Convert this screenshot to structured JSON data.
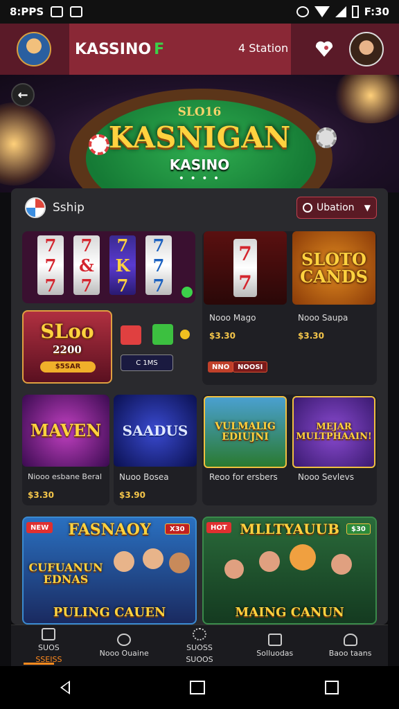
{
  "status_bar": {
    "left_text": "8:PPS",
    "time": "F:30"
  },
  "app_header": {
    "brand": "KASSINO",
    "brand_mark": "F",
    "status_label": "4 Station"
  },
  "hero": {
    "small_title": "SLO16",
    "big_title": "KASNIGAN",
    "sub_title": "KASINO",
    "dots": "• • • •"
  },
  "panel": {
    "section_label": "Sship",
    "filter_label": "Ubation"
  },
  "games": {
    "g1": {
      "reels": [
        [
          "7",
          "7",
          "7"
        ],
        [
          "7",
          "&",
          "7"
        ],
        [
          "7",
          "K",
          "7"
        ],
        [
          "7",
          "7",
          "7"
        ]
      ]
    },
    "g2": {
      "reels": [
        [
          "7",
          "7"
        ]
      ],
      "name": "Nooo Mago",
      "price": "$3.30"
    },
    "g3": {
      "title_lines": [
        "SLOTO",
        "CANDS"
      ],
      "name": "Nooo Saupa",
      "price": "$3.30"
    },
    "g4": {
      "title": "SLoo",
      "subtitle": "2200",
      "button": "$5SAR",
      "chip_label": "C 1MS"
    },
    "g4_tags": [
      "NNO",
      "NOOSI"
    ],
    "g5": {
      "title": "MAVEN",
      "name": "Niooo esbane Beral",
      "price": "$3.30"
    },
    "g6": {
      "title": "SAADUS",
      "name": "Nuoo Bosea",
      "price": "$3.90"
    },
    "g7": {
      "title_lines": [
        "VULMALIG",
        "EDIUJNI"
      ],
      "name": "Reoo for ersbers"
    },
    "g8": {
      "title_lines": [
        "MEJAR",
        "MULTPHAAIN!"
      ],
      "name": "Nooo Sevlevs"
    },
    "g9": {
      "banner": "FASNAOY",
      "badge": "X30",
      "art_lines": [
        "CUFUANUN",
        "EDNAS"
      ],
      "footer": "PULING CAUEN",
      "corner_tag": "NEW"
    },
    "g10": {
      "banner": "MLLTYAUUB",
      "badge": "$30",
      "footer": "MAING CANUN",
      "corner_tag": "HOT"
    }
  },
  "bottom_nav": [
    {
      "top": "SUOS",
      "bottom": "SSEISS"
    },
    {
      "top": "",
      "bottom": "Nooo Ouaine"
    },
    {
      "top": "SUOSS",
      "bottom": "SUOOS"
    },
    {
      "top": "",
      "bottom": "Solluodas"
    },
    {
      "top": "",
      "bottom": "Baoo taans"
    }
  ],
  "colors": {
    "header_bg": "#5a1a28",
    "brand_box": "#8a2836",
    "accent_gold": "#ffd23f",
    "price_gold": "#f5c64a",
    "active_tab": "#ff8a1e"
  }
}
